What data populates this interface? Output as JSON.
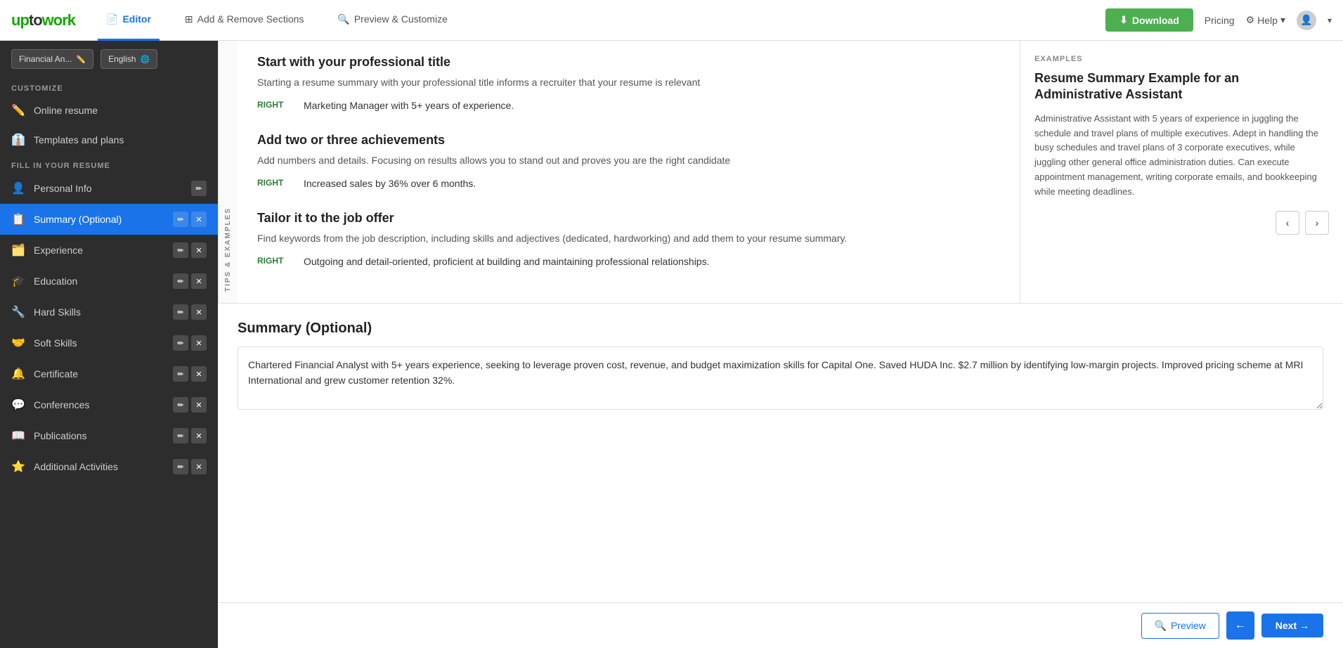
{
  "logo": {
    "text": "uptowork"
  },
  "topnav": {
    "tabs": [
      {
        "id": "editor",
        "label": "Editor",
        "active": true
      },
      {
        "id": "add-remove",
        "label": "Add & Remove Sections",
        "active": false
      },
      {
        "id": "preview",
        "label": "Preview & Customize",
        "active": false
      }
    ],
    "download_label": "Download",
    "pricing_label": "Pricing",
    "help_label": "Help"
  },
  "sidebar": {
    "resume_name_btn": "Financial An...",
    "language_btn": "English",
    "customize_label": "Customize",
    "fill_label": "Fill in Your Resume",
    "items": [
      {
        "id": "online-resume",
        "label": "Online resume",
        "icon": "✏️",
        "active": false
      },
      {
        "id": "templates",
        "label": "Templates and plans",
        "icon": "👔",
        "active": false
      },
      {
        "id": "personal-info",
        "label": "Personal Info",
        "icon": "👤",
        "active": false,
        "has_actions": true
      },
      {
        "id": "summary",
        "label": "Summary (Optional)",
        "icon": "📋",
        "active": true,
        "has_actions": true
      },
      {
        "id": "experience",
        "label": "Experience",
        "icon": "🗂️",
        "active": false,
        "has_actions": true
      },
      {
        "id": "education",
        "label": "Education",
        "icon": "🎓",
        "active": false,
        "has_actions": true
      },
      {
        "id": "hard-skills",
        "label": "Hard Skills",
        "icon": "🔧",
        "active": false,
        "has_actions": true
      },
      {
        "id": "soft-skills",
        "label": "Soft Skills",
        "icon": "🤝",
        "active": false,
        "has_actions": true
      },
      {
        "id": "certificate",
        "label": "Certificate",
        "icon": "🔔",
        "active": false,
        "has_actions": true
      },
      {
        "id": "conferences",
        "label": "Conferences",
        "icon": "💬",
        "active": false,
        "has_actions": true
      },
      {
        "id": "publications",
        "label": "Publications",
        "icon": "📖",
        "active": false,
        "has_actions": true
      },
      {
        "id": "additional",
        "label": "Additional Activities",
        "icon": "⭐",
        "active": false,
        "has_actions": true
      }
    ]
  },
  "tips": {
    "rotated_label": "Tips & Examples",
    "blocks": [
      {
        "heading": "Start with your professional title",
        "text": "Starting a resume summary with your professional title informs a recruiter that your resume is relevant",
        "example_label": "RIGHT",
        "example_text": "Marketing Manager with 5+ years of experience."
      },
      {
        "heading": "Add two or three achievements",
        "text": "Add numbers and details. Focusing on results allows you to stand out and proves you are the right candidate",
        "example_label": "RIGHT",
        "example_text": "Increased sales by 36% over 6 months."
      },
      {
        "heading": "Tailor it to the job offer",
        "text": "Find keywords from the job description, including skills and adjectives (dedicated, hardworking) and add them to your resume summary.",
        "example_label": "RIGHT",
        "example_text": "Outgoing and detail-oriented, proficient at building and maintaining professional relationships."
      }
    ],
    "examples_section": {
      "label": "EXAMPLES",
      "title": "Resume Summary Example for an Administrative Assistant",
      "body": "Administrative Assistant with 5 years of experience in juggling the schedule and travel plans of multiple executives. Adept in handling the busy schedules and travel plans of 3 corporate executives, while juggling other general office administration duties. Can execute appointment management, writing corporate emails, and bookkeeping while meeting deadlines."
    }
  },
  "summary": {
    "title": "Summary (Optional)",
    "content": "Chartered Financial Analyst with 5+ years experience, seeking to leverage proven cost, revenue, and budget maximization skills for Capital One. Saved HUDA Inc. $2.7 million by identifying low-margin projects. Improved pricing scheme at MRI International and grew customer retention 32%."
  },
  "bottom_bar": {
    "preview_label": "Preview",
    "back_label": "←",
    "next_label": "Next →"
  }
}
